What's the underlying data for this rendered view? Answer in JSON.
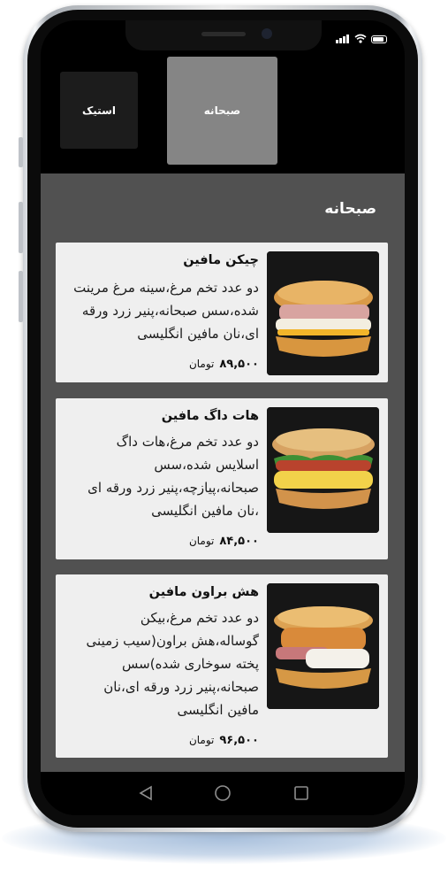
{
  "tabs": [
    {
      "label": "استیک",
      "active": false
    },
    {
      "label": "صبحانه",
      "active": true
    }
  ],
  "section": {
    "title": "صبحانه"
  },
  "items": [
    {
      "name": "چیکن مافین",
      "description": "دو عدد تخم مرغ،سینه مرغ مرینت شده،سس صبحانه،پنیر زرد ورقه ای،نان مافین انگلیسی",
      "price": "۸۹,۵۰۰",
      "currency": "تومان",
      "image_icon": "chicken-muffin-sandwich"
    },
    {
      "name": "هات داگ مافین",
      "description": "دو عدد تخم مرغ،هات داگ اسلایس شده،سس صبحانه،پیازچه،پنیر زرد ورقه ای ،نان مافین انگلیسی",
      "price": "۸۴,۵۰۰",
      "currency": "تومان",
      "image_icon": "hotdog-muffin-sandwich"
    },
    {
      "name": "هش براون مافین",
      "description": "دو عدد تخم مرغ،بیکن گوساله،هش براون(سیب زمینی پخته سوخاری شده)سس صبحانه،پنیر زرد ورقه ای،نان مافین انگلیسی",
      "price": "۹۶,۵۰۰",
      "currency": "تومان",
      "image_icon": "hashbrown-muffin-sandwich"
    }
  ],
  "navbar": {
    "icons": [
      "back-icon",
      "home-icon",
      "recents-icon"
    ]
  },
  "colors": {
    "content_bg": "#515151",
    "card_bg": "#efefef",
    "active_tab": "#858585",
    "inactive_tab": "#1c1c1c"
  }
}
